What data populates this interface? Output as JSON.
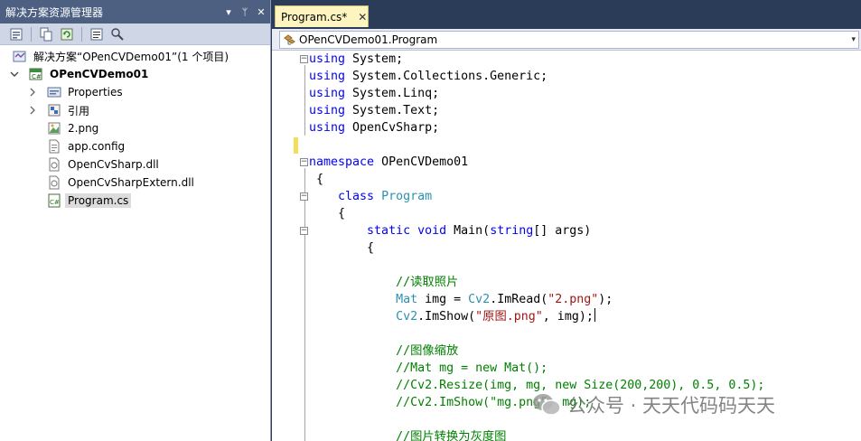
{
  "solution_explorer": {
    "title": "解决方案资源管理器",
    "title_buttons": [
      "▾",
      "ᛘ",
      "✕"
    ],
    "solution_label": "解决方案“OPenCVDemo01”(1 个项目)",
    "project_label": "OPenCVDemo01",
    "items": [
      {
        "label": "Properties",
        "icon": "properties-icon",
        "expandable": true
      },
      {
        "label": "引用",
        "icon": "references-icon",
        "expandable": true
      },
      {
        "label": "2.png",
        "icon": "image-file-icon",
        "expandable": false
      },
      {
        "label": "app.config",
        "icon": "config-file-icon",
        "expandable": false
      },
      {
        "label": "OpenCvSharp.dll",
        "icon": "dll-file-icon",
        "expandable": false
      },
      {
        "label": "OpenCvSharpExtern.dll",
        "icon": "dll-file-icon",
        "expandable": false
      },
      {
        "label": "Program.cs",
        "icon": "csharp-file-icon",
        "expandable": false,
        "selected": true
      }
    ]
  },
  "editor": {
    "tab_label": "Program.cs*",
    "tab_close": "✕",
    "nav_class": "OPenCVDemo01.Program",
    "nav_dropdown": "▾",
    "lines": [
      "using System;",
      "using System.Collections.Generic;",
      "using System.Linq;",
      "using System.Text;",
      "using OpenCvSharp;",
      "",
      "namespace OPenCVDemo01",
      "{",
      "    class Program",
      "    {",
      "        static void Main(string[] args)",
      "        {",
      "",
      "            //读取照片",
      "            Mat img = Cv2.ImRead(\"2.png\");",
      "            Cv2.ImShow(\"原图.png\", img);",
      "",
      "            //图像缩放",
      "            //Mat mg = new Mat();",
      "            //Cv2.Resize(img, mg, new Size(200,200), 0.5, 0.5);",
      "            //Cv2.ImShow(\"mg.png\", mg);",
      "",
      "            //图片转换为灰度图"
    ]
  },
  "watermark": {
    "text": "公众号 · 天天代码码天天"
  }
}
